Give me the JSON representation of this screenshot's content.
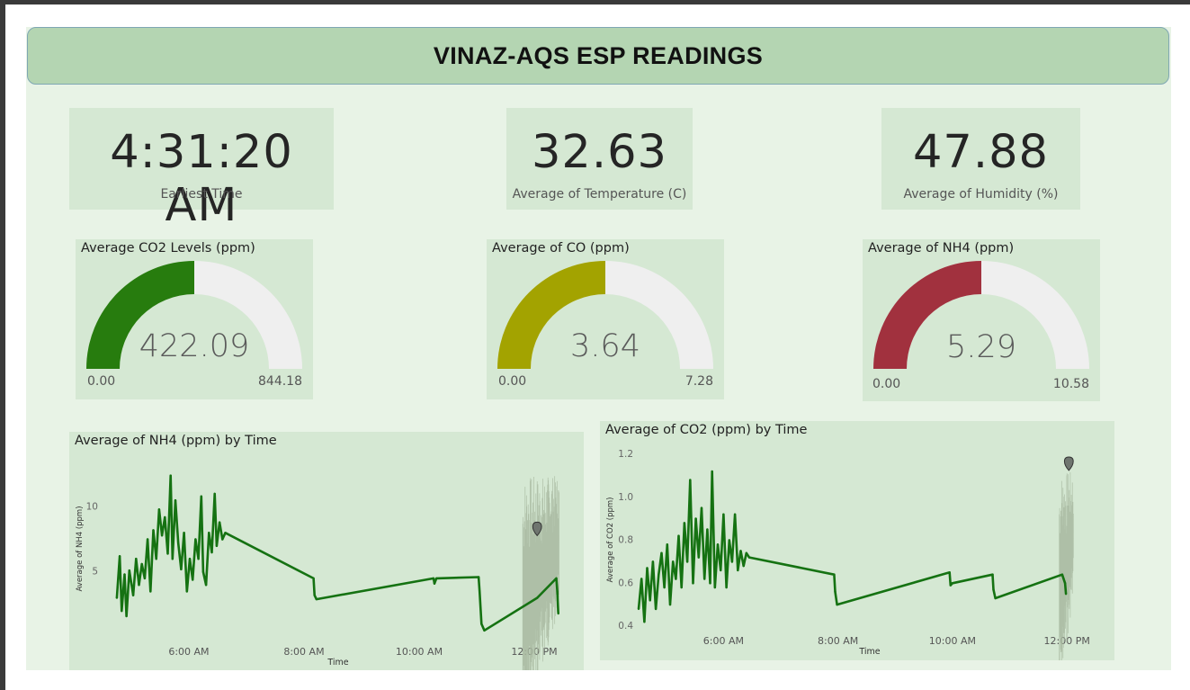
{
  "title": "VINAZ-AQS ESP READINGS",
  "cards": [
    {
      "value": "4:31:20 AM",
      "label": "Earliest Time"
    },
    {
      "value": "32.63",
      "label": "Average of Temperature (C)"
    },
    {
      "value": "47.88",
      "label": "Average of Humidity (%)"
    }
  ],
  "gauges": [
    {
      "title": "Average CO2 Levels (ppm)",
      "value_text": "422.09",
      "min_text": "0.00",
      "max_text": "844.18",
      "value": 422.09,
      "min": 0,
      "max": 844.18,
      "color": "#277c0e"
    },
    {
      "title": "Average of CO (ppm)",
      "value_text": "3.64",
      "min_text": "0.00",
      "max_text": "7.28",
      "value": 3.64,
      "min": 0,
      "max": 7.28,
      "color": "#a3a300"
    },
    {
      "title": "Average of NH4 (ppm)",
      "value_text": "5.29",
      "min_text": "0.00",
      "max_text": "10.58",
      "value": 5.29,
      "min": 0,
      "max": 10.58,
      "color": "#a1313e"
    }
  ],
  "chart_data": [
    {
      "type": "line",
      "title": "Average of NH4 (ppm) by Time",
      "xlabel": "Time",
      "ylabel": "Average of NH4 (ppm)",
      "xlim": [
        "4:31 AM",
        "12:30 PM"
      ],
      "ylim": [
        0,
        13
      ],
      "yticks": [
        5,
        10
      ],
      "xticks": [
        "6:00 AM",
        "8:00 AM",
        "10:00 AM",
        "12:00 PM"
      ],
      "line_color": "#157212",
      "series": [
        {
          "values": [
            [
              "4:45 AM",
              3.0
            ],
            [
              "4:48 AM",
              6.2
            ],
            [
              "4:50 AM",
              2.0
            ],
            [
              "4:53 AM",
              4.8
            ],
            [
              "4:55 AM",
              1.6
            ],
            [
              "4:58 AM",
              5.1
            ],
            [
              "5:02 AM",
              3.2
            ],
            [
              "5:05 AM",
              6.0
            ],
            [
              "5:08 AM",
              4.0
            ],
            [
              "5:11 AM",
              5.6
            ],
            [
              "5:14 AM",
              4.5
            ],
            [
              "5:17 AM",
              7.5
            ],
            [
              "5:20 AM",
              3.5
            ],
            [
              "5:23 AM",
              8.2
            ],
            [
              "5:26 AM",
              6.0
            ],
            [
              "5:29 AM",
              9.8
            ],
            [
              "5:32 AM",
              7.8
            ],
            [
              "5:35 AM",
              9.2
            ],
            [
              "5:38 AM",
              6.4
            ],
            [
              "5:41 AM",
              12.4
            ],
            [
              "5:43 AM",
              6.0
            ],
            [
              "5:46 AM",
              10.5
            ],
            [
              "5:49 AM",
              7.2
            ],
            [
              "5:52 AM",
              5.2
            ],
            [
              "5:55 AM",
              8.0
            ],
            [
              "5:58 AM",
              3.5
            ],
            [
              "6:01 AM",
              6.0
            ],
            [
              "6:04 AM",
              4.4
            ],
            [
              "6:07 AM",
              7.5
            ],
            [
              "6:10 AM",
              6.0
            ],
            [
              "6:13 AM",
              10.8
            ],
            [
              "6:15 AM",
              5.0
            ],
            [
              "6:18 AM",
              4.0
            ],
            [
              "6:21 AM",
              8.0
            ],
            [
              "6:24 AM",
              6.5
            ],
            [
              "6:27 AM",
              11.0
            ],
            [
              "6:29 AM",
              7.0
            ],
            [
              "6:32 AM",
              8.8
            ],
            [
              "6:35 AM",
              7.5
            ],
            [
              "6:38 AM",
              8.0
            ],
            [
              "8:10 AM",
              4.5
            ],
            [
              "8:11 AM",
              3.2
            ],
            [
              "8:13 AM",
              2.9
            ],
            [
              "10:15 AM",
              4.5
            ],
            [
              "10:16 AM",
              4.1
            ],
            [
              "10:18 AM",
              4.5
            ],
            [
              "11:02 AM",
              4.6
            ],
            [
              "11:03 AM",
              3.5
            ],
            [
              "11:05 AM",
              1.0
            ],
            [
              "11:08 AM",
              0.5
            ],
            [
              "12:03 PM",
              3.0
            ],
            [
              "12:23 PM",
              4.5
            ],
            [
              "12:24 PM",
              3.5
            ],
            [
              "12:25 PM",
              1.8
            ]
          ]
        }
      ]
    },
    {
      "type": "line",
      "title": "Average of CO2 (ppm) by Time",
      "xlabel": "Time",
      "ylabel": "Average of CO2 (ppm)",
      "xlim": [
        "4:31 AM",
        "12:30 PM"
      ],
      "ylim": [
        0.4,
        1.2
      ],
      "yticks": [
        0.4,
        0.6,
        0.8,
        1.0,
        1.2
      ],
      "ytick_labels": [
        "0.4",
        "0.6",
        "0.8",
        "1.0",
        "1.2"
      ],
      "xticks": [
        "6:00 AM",
        "8:00 AM",
        "10:00 AM",
        "12:00 PM"
      ],
      "line_color": "#157212",
      "series": [
        {
          "values": [
            [
              "4:31 AM",
              0.48
            ],
            [
              "4:34 AM",
              0.62
            ],
            [
              "4:37 AM",
              0.42
            ],
            [
              "4:40 AM",
              0.67
            ],
            [
              "4:43 AM",
              0.52
            ],
            [
              "4:46 AM",
              0.7
            ],
            [
              "4:49 AM",
              0.48
            ],
            [
              "4:52 AM",
              0.64
            ],
            [
              "4:55 AM",
              0.74
            ],
            [
              "4:58 AM",
              0.58
            ],
            [
              "5:01 AM",
              0.78
            ],
            [
              "5:04 AM",
              0.5
            ],
            [
              "5:07 AM",
              0.7
            ],
            [
              "5:10 AM",
              0.62
            ],
            [
              "5:13 AM",
              0.82
            ],
            [
              "5:16 AM",
              0.58
            ],
            [
              "5:19 AM",
              0.88
            ],
            [
              "5:22 AM",
              0.7
            ],
            [
              "5:25 AM",
              1.08
            ],
            [
              "5:28 AM",
              0.6
            ],
            [
              "5:31 AM",
              0.9
            ],
            [
              "5:34 AM",
              0.72
            ],
            [
              "5:37 AM",
              0.95
            ],
            [
              "5:40 AM",
              0.62
            ],
            [
              "5:43 AM",
              0.85
            ],
            [
              "5:46 AM",
              0.6
            ],
            [
              "5:48 AM",
              1.12
            ],
            [
              "5:51 AM",
              0.58
            ],
            [
              "5:54 AM",
              0.78
            ],
            [
              "5:57 AM",
              0.66
            ],
            [
              "6:00 AM",
              0.92
            ],
            [
              "6:03 AM",
              0.58
            ],
            [
              "6:06 AM",
              0.8
            ],
            [
              "6:09 AM",
              0.7
            ],
            [
              "6:12 AM",
              0.92
            ],
            [
              "6:15 AM",
              0.66
            ],
            [
              "6:18 AM",
              0.75
            ],
            [
              "6:21 AM",
              0.68
            ],
            [
              "6:24 AM",
              0.74
            ],
            [
              "6:27 AM",
              0.72
            ],
            [
              "7:56 AM",
              0.64
            ],
            [
              "7:57 AM",
              0.56
            ],
            [
              "7:59 AM",
              0.5
            ],
            [
              "9:57 AM",
              0.65
            ],
            [
              "9:58 AM",
              0.59
            ],
            [
              "10:00 AM",
              0.6
            ],
            [
              "10:42 AM",
              0.64
            ],
            [
              "10:43 AM",
              0.57
            ],
            [
              "10:45 AM",
              0.53
            ],
            [
              "11:55 AM",
              0.64
            ],
            [
              "11:58 AM",
              0.6
            ],
            [
              "11:59 AM",
              0.55
            ]
          ]
        }
      ]
    }
  ]
}
